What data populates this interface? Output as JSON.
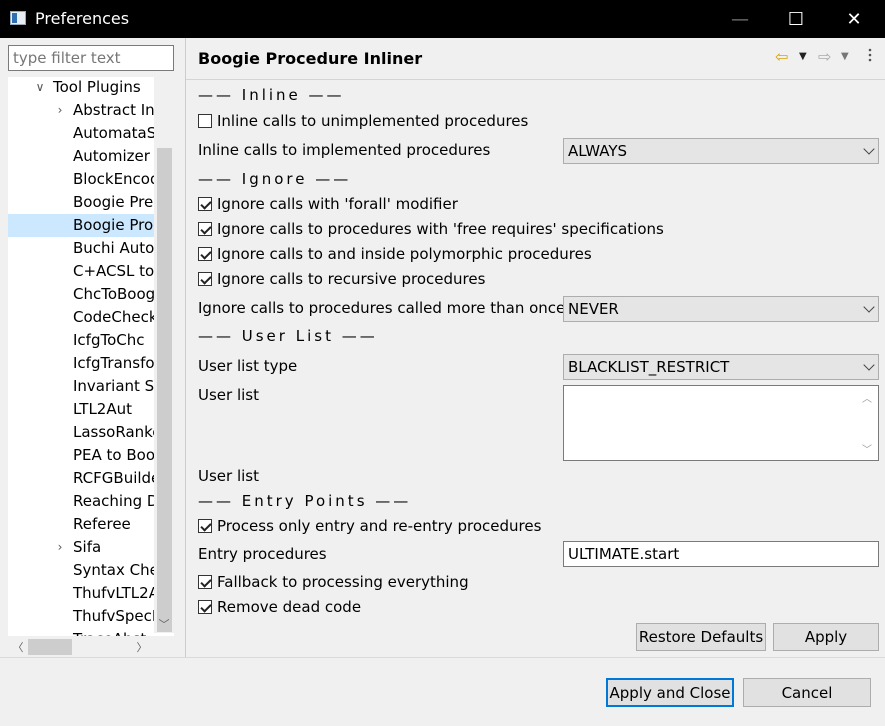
{
  "window": {
    "title": "Preferences",
    "minimize_glyph": "—",
    "maximize_glyph": "☐",
    "close_glyph": "✕"
  },
  "sidebar": {
    "filter_placeholder": "type filter text",
    "tree": [
      {
        "label": "Tool Plugins",
        "level": 1,
        "expander": "expanded"
      },
      {
        "label": "Abstract In",
        "level": 2,
        "expander": "collapsed"
      },
      {
        "label": "AutomataS",
        "level": 2
      },
      {
        "label": "Automizer",
        "level": 2
      },
      {
        "label": "BlockEncod",
        "level": 2
      },
      {
        "label": "Boogie Pre",
        "level": 2
      },
      {
        "label": "Boogie Pro",
        "level": 2,
        "selected": true
      },
      {
        "label": "Buchi Auto",
        "level": 2
      },
      {
        "label": "C+ACSL to",
        "level": 2
      },
      {
        "label": "ChcToBoog",
        "level": 2
      },
      {
        "label": "CodeCheck",
        "level": 2
      },
      {
        "label": "IcfgToChc",
        "level": 2
      },
      {
        "label": "IcfgTransfo",
        "level": 2
      },
      {
        "label": "Invariant Sy",
        "level": 2
      },
      {
        "label": "LTL2Aut",
        "level": 2
      },
      {
        "label": "LassoRanke",
        "level": 2
      },
      {
        "label": "PEA to Boo",
        "level": 2
      },
      {
        "label": "RCFGBuilde",
        "level": 2
      },
      {
        "label": "Reaching D",
        "level": 2
      },
      {
        "label": "Referee",
        "level": 2
      },
      {
        "label": "Sifa",
        "level": 2,
        "expander": "collapsed"
      },
      {
        "label": "Syntax Che",
        "level": 2
      },
      {
        "label": "ThufvLTL2A",
        "level": 2
      },
      {
        "label": "ThufvSpecL",
        "level": 2
      },
      {
        "label": "TraceAbst",
        "level": 2
      }
    ]
  },
  "page": {
    "title": "Boogie Procedure Inliner",
    "nav": {
      "back_icon": "⇦",
      "forward_icon": "⇨",
      "dropdown_icon": "▼"
    },
    "inline_group": "——  Inline  ——",
    "inline_unimplemented": {
      "label": "Inline calls to unimplemented procedures",
      "checked": false
    },
    "inline_implemented": {
      "label": "Inline calls to implemented procedures",
      "value": "ALWAYS"
    },
    "ignore_group": "——  Ignore  ——",
    "ignore_forall": {
      "label": "Ignore calls with 'forall' modifier",
      "checked": true
    },
    "ignore_free_requires": {
      "label": "Ignore calls to procedures with 'free requires' specifications",
      "checked": true
    },
    "ignore_polymorphic": {
      "label": "Ignore calls to and inside polymorphic procedures",
      "checked": true
    },
    "ignore_recursive": {
      "label": "Ignore calls to recursive procedures",
      "checked": true
    },
    "ignore_called_more_than_once": {
      "label": "Ignore calls to procedures called more than once",
      "value": "NEVER"
    },
    "userlist_group": "——  User List  ——",
    "user_list_type": {
      "label": "User list type",
      "value": "BLACKLIST_RESTRICT"
    },
    "user_list": {
      "label": "User list",
      "value": ""
    },
    "user_list_label_2": "User list",
    "entry_group": "——  Entry Points  ——",
    "process_entry": {
      "label": "Process only entry and re-entry procedures",
      "checked": true
    },
    "entry_procedures": {
      "label": "Entry procedures",
      "value": "ULTIMATE.start"
    },
    "fallback": {
      "label": "Fallback to processing everything",
      "checked": true
    },
    "remove_dead_code": {
      "label": "Remove dead code",
      "checked": true
    },
    "restore_defaults_label": "Restore Defaults",
    "apply_label": "Apply"
  },
  "footer": {
    "apply_close_label": "Apply and Close",
    "cancel_label": "Cancel"
  }
}
